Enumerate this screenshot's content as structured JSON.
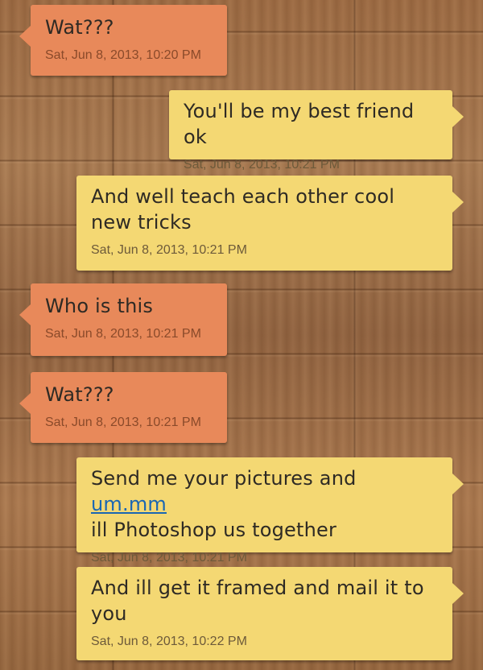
{
  "messages": [
    {
      "direction": "incoming",
      "text": "Wat???",
      "time": "Sat, Jun 8, 2013, 10:20 PM"
    },
    {
      "direction": "outgoing",
      "text": "You'll be my best friend ok",
      "time": "Sat, Jun 8, 2013, 10:21 PM"
    },
    {
      "direction": "outgoing",
      "text": "And well teach each other cool new tricks",
      "time": "Sat, Jun 8, 2013, 10:21 PM"
    },
    {
      "direction": "incoming",
      "text": "Who is this",
      "time": "Sat, Jun 8, 2013, 10:21 PM"
    },
    {
      "direction": "incoming",
      "text": "Wat???",
      "time": "Sat, Jun 8, 2013, 10:21 PM"
    },
    {
      "direction": "outgoing",
      "text_before_link": "Send me your pictures and ",
      "link": "um.mm",
      "text_after_link": "ill Photoshop us together",
      "time": "Sat, Jun 8, 2013, 10:21 PM"
    },
    {
      "direction": "outgoing",
      "text": "And ill get it framed and mail it to you",
      "time": "Sat, Jun 8, 2013, 10:22 PM"
    }
  ],
  "colors": {
    "incoming_bubble": "#e8895a",
    "outgoing_bubble": "#f4d873",
    "link": "#1a66b3"
  }
}
